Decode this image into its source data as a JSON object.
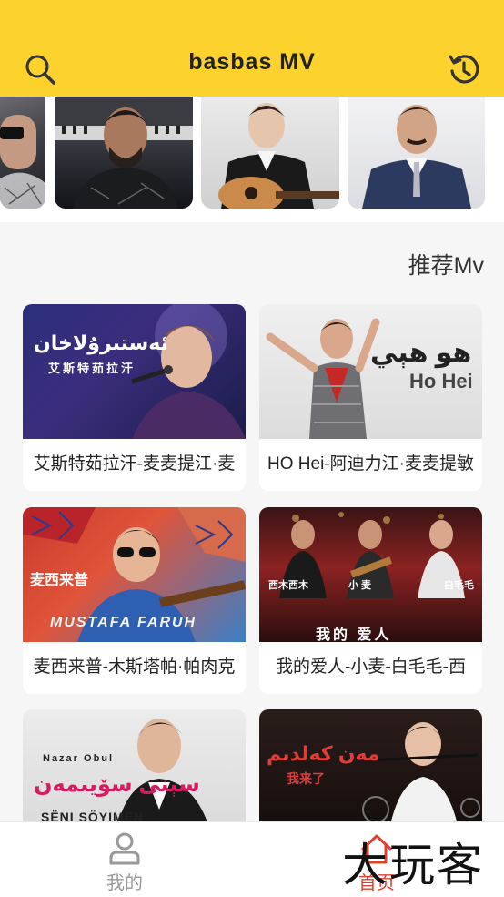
{
  "header": {
    "title": "basbas MV",
    "search_icon": "search-icon",
    "history_icon": "history-icon",
    "color": "#fdd22d"
  },
  "artists": [
    {
      "name": "artist-1"
    },
    {
      "name": "artist-2"
    },
    {
      "name": "artist-3"
    },
    {
      "name": "artist-4"
    }
  ],
  "section": {
    "title": "推荐Mv"
  },
  "videos": [
    {
      "caption": "艾斯特茹拉汗-麦麦提江·麦",
      "overlay_line1": "ئەستىرۇلاخان",
      "overlay_line2": "艾斯特茹拉汗"
    },
    {
      "caption": "HO Hei-阿迪力江·麦麦提敏",
      "overlay_line1": "ھو ھېي",
      "overlay_line2": "Ho Hei"
    },
    {
      "caption": "麦西来普-木斯塔帕·帕肉克",
      "overlay_line1": "麦西来普",
      "overlay_line2": "MUSTAFA FARUH"
    },
    {
      "caption": "我的爱人-小麦-白毛毛-西",
      "overlay_line1": "西木西木",
      "overlay_line2": "小 麦",
      "overlay_line3": "白毛毛",
      "overlay_line4": "我的 爱人"
    },
    {
      "caption": "",
      "overlay_line1": "Nazar Obul",
      "overlay_line2": "سېنى سۆيىمەن",
      "overlay_line3": "SËNI SÖYIMEN"
    },
    {
      "caption": "",
      "overlay_line1": "مەن كەلدىم",
      "overlay_line2": "我来了"
    }
  ],
  "tabbar": {
    "mine_label": "我的",
    "home_label": "首页",
    "mine_icon": "user-icon",
    "home_icon": "home-icon",
    "active_color": "#e0402d"
  },
  "watermark": "大玩客"
}
